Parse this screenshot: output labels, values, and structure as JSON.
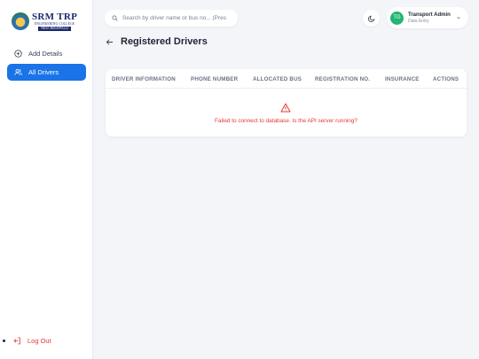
{
  "logo": {
    "name": "SRM TRP",
    "subtitle": "ENGINEERING COLLEGE",
    "city": "TIRUCHIRAPPALLI"
  },
  "sidebar": {
    "items": [
      {
        "label": "Add Details",
        "icon": "plus-circle-icon"
      },
      {
        "label": "All Drivers",
        "icon": "users-icon",
        "active": true
      }
    ],
    "logout_label": "Log Out"
  },
  "search": {
    "placeholder": "Search by driver name or bus no... (Pres"
  },
  "user": {
    "initials": "TG",
    "name": "Transport Admin",
    "role": "Data Entry"
  },
  "page": {
    "title": "Registered Drivers"
  },
  "table": {
    "columns": [
      "DRIVER INFORMATION",
      "PHONE NUMBER",
      "ALLOCATED BUS",
      "REGISTRATION NO.",
      "INSURANCE",
      "ACTIONS"
    ]
  },
  "error": {
    "message": "Failed to connect to database. Is the API server running?",
    "icon": "warning-triangle-icon"
  },
  "colors": {
    "primary": "#1a73e8",
    "danger": "#e53935",
    "avatar": "#22b573",
    "background": "#f3f5f9"
  }
}
